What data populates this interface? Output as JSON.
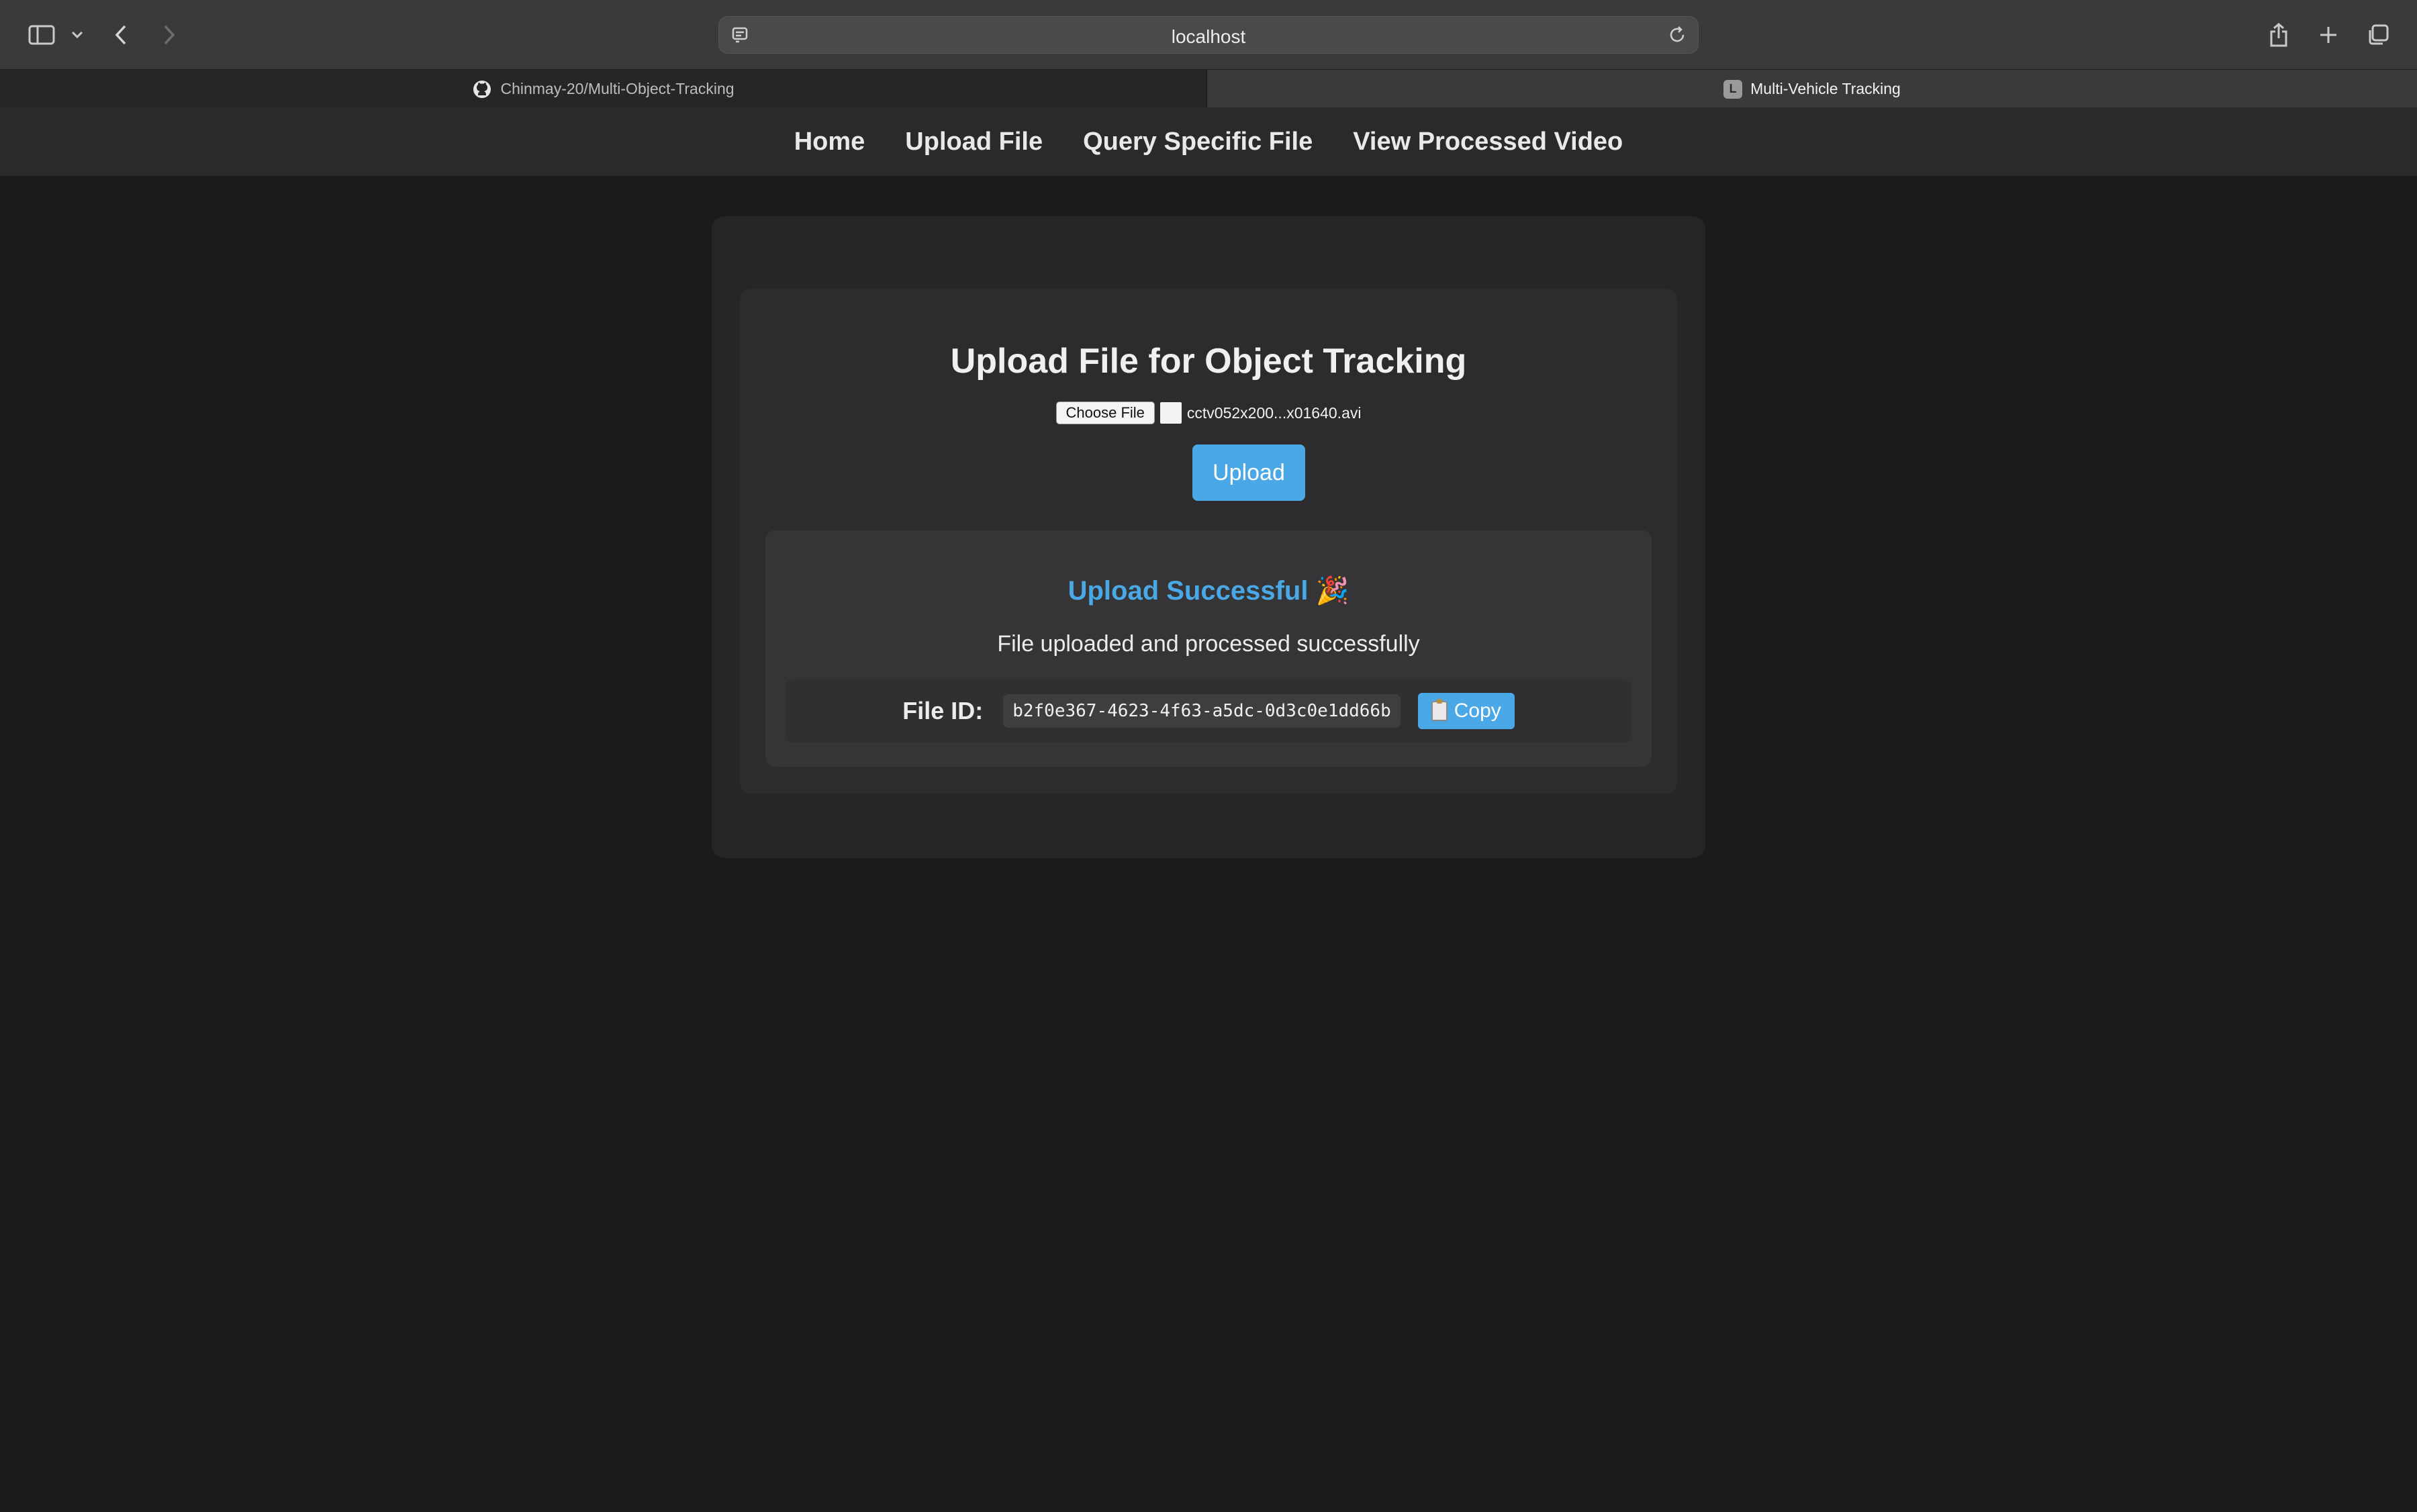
{
  "browser": {
    "address": "localhost",
    "tabs": [
      {
        "label": "Chinmay-20/Multi-Object-Tracking",
        "icon": "github-icon"
      },
      {
        "label": "Multi-Vehicle Tracking",
        "icon": "L"
      }
    ]
  },
  "nav": {
    "items": [
      "Home",
      "Upload File",
      "Query Specific File",
      "View Processed Video"
    ]
  },
  "upload_card": {
    "title": "Upload File for Object Tracking",
    "choose_label": "Choose File",
    "file_name": "cctv052x200...x01640.avi",
    "upload_label": "Upload"
  },
  "result": {
    "title": "Upload Successful",
    "emoji": "🎉",
    "message": "File uploaded and processed successfully",
    "file_id_label": "File ID:",
    "file_id": "b2f0e367-4623-4f63-a5dc-0d3c0e1dd66b",
    "copy_label": "Copy"
  },
  "colors": {
    "accent": "#4aa8e6",
    "background": "#1b1b1d"
  }
}
